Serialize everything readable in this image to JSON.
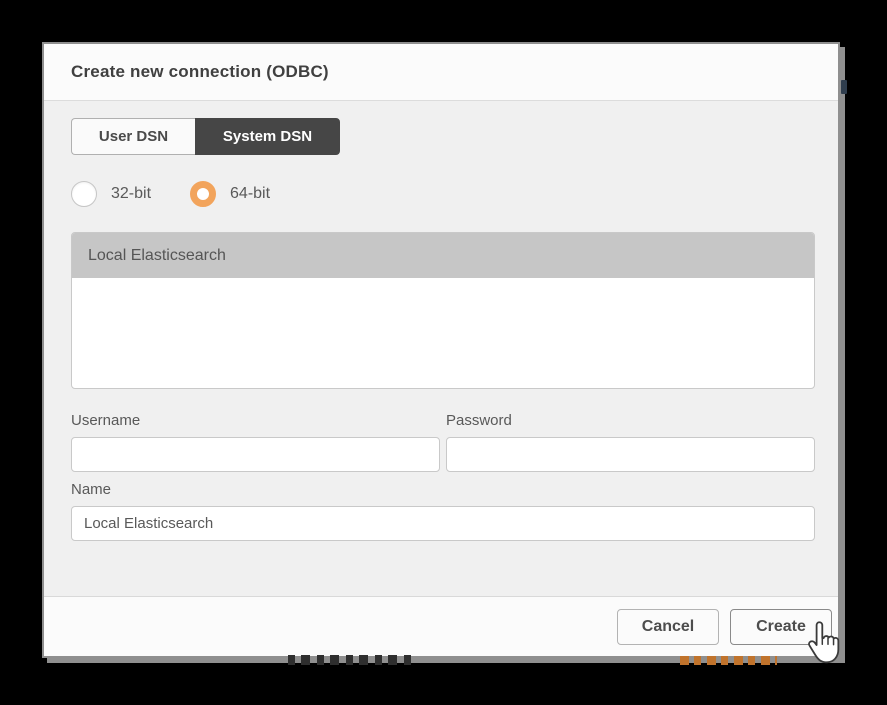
{
  "dialog": {
    "title": "Create new connection (ODBC)",
    "tabs": [
      {
        "label": "User DSN",
        "active": false
      },
      {
        "label": "System DSN",
        "active": true
      }
    ],
    "radios": [
      {
        "label": "32-bit",
        "selected": false
      },
      {
        "label": "64-bit",
        "selected": true
      }
    ],
    "dsn_list": {
      "items": [
        {
          "label": "Local Elasticsearch",
          "selected": true
        }
      ]
    },
    "fields": {
      "username": {
        "label": "Username",
        "value": ""
      },
      "password": {
        "label": "Password",
        "value": ""
      },
      "name": {
        "label": "Name",
        "value": "Local Elasticsearch"
      }
    },
    "footer": {
      "cancel_label": "Cancel",
      "create_label": "Create"
    }
  },
  "cursor": {
    "type": "hand-pointer"
  },
  "colors": {
    "backdrop": "#000000",
    "modal_body_bg": "#f0f0f0",
    "header_footer_bg": "#fbfbfb",
    "active_tab_bg": "#464646",
    "radio_accent_orange": "#f2a45c",
    "selected_row_bg": "#c6c6c6",
    "text_gray": "#595959",
    "modal_border": "#8f8f8f",
    "fragment_orange": "#c0732c"
  }
}
